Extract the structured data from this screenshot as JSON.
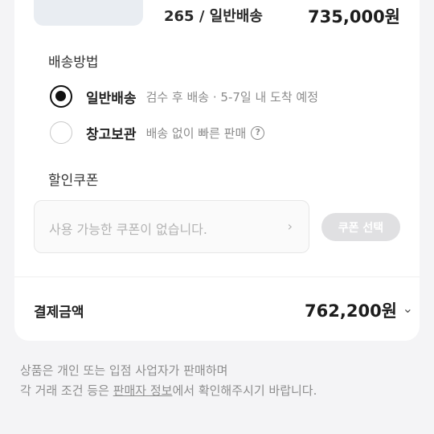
{
  "product": {
    "option": "265 / 일반배송",
    "price": "735,000원"
  },
  "shipping": {
    "title": "배송방법",
    "options": [
      {
        "label": "일반배송",
        "desc": "검수 후 배송 · 5-7일 내 도착 예정",
        "selected": true
      },
      {
        "label": "창고보관",
        "desc": "배송 없이 빠른 판매",
        "selected": false,
        "help_icon": "?"
      }
    ]
  },
  "coupon": {
    "title": "할인쿠폰",
    "placeholder": "사용 가능한 쿠폰이 없습니다.",
    "arrow": "›",
    "button": "쿠폰 선택"
  },
  "payment": {
    "label": "결제금액",
    "total": "762,200원",
    "chevron": "⌄"
  },
  "notice": {
    "line1": "상품은 개인 또는 입점 사업자가 판매하며",
    "line2_pre": "각 거래 조건 등은 ",
    "line2_link": "판매자 정보",
    "line2_post": "에서 확인해주시기 바랍니다."
  },
  "colors": {
    "accent": "#111111",
    "muted": "#8b8b8b",
    "disabled_button": "#e0e0e2"
  }
}
